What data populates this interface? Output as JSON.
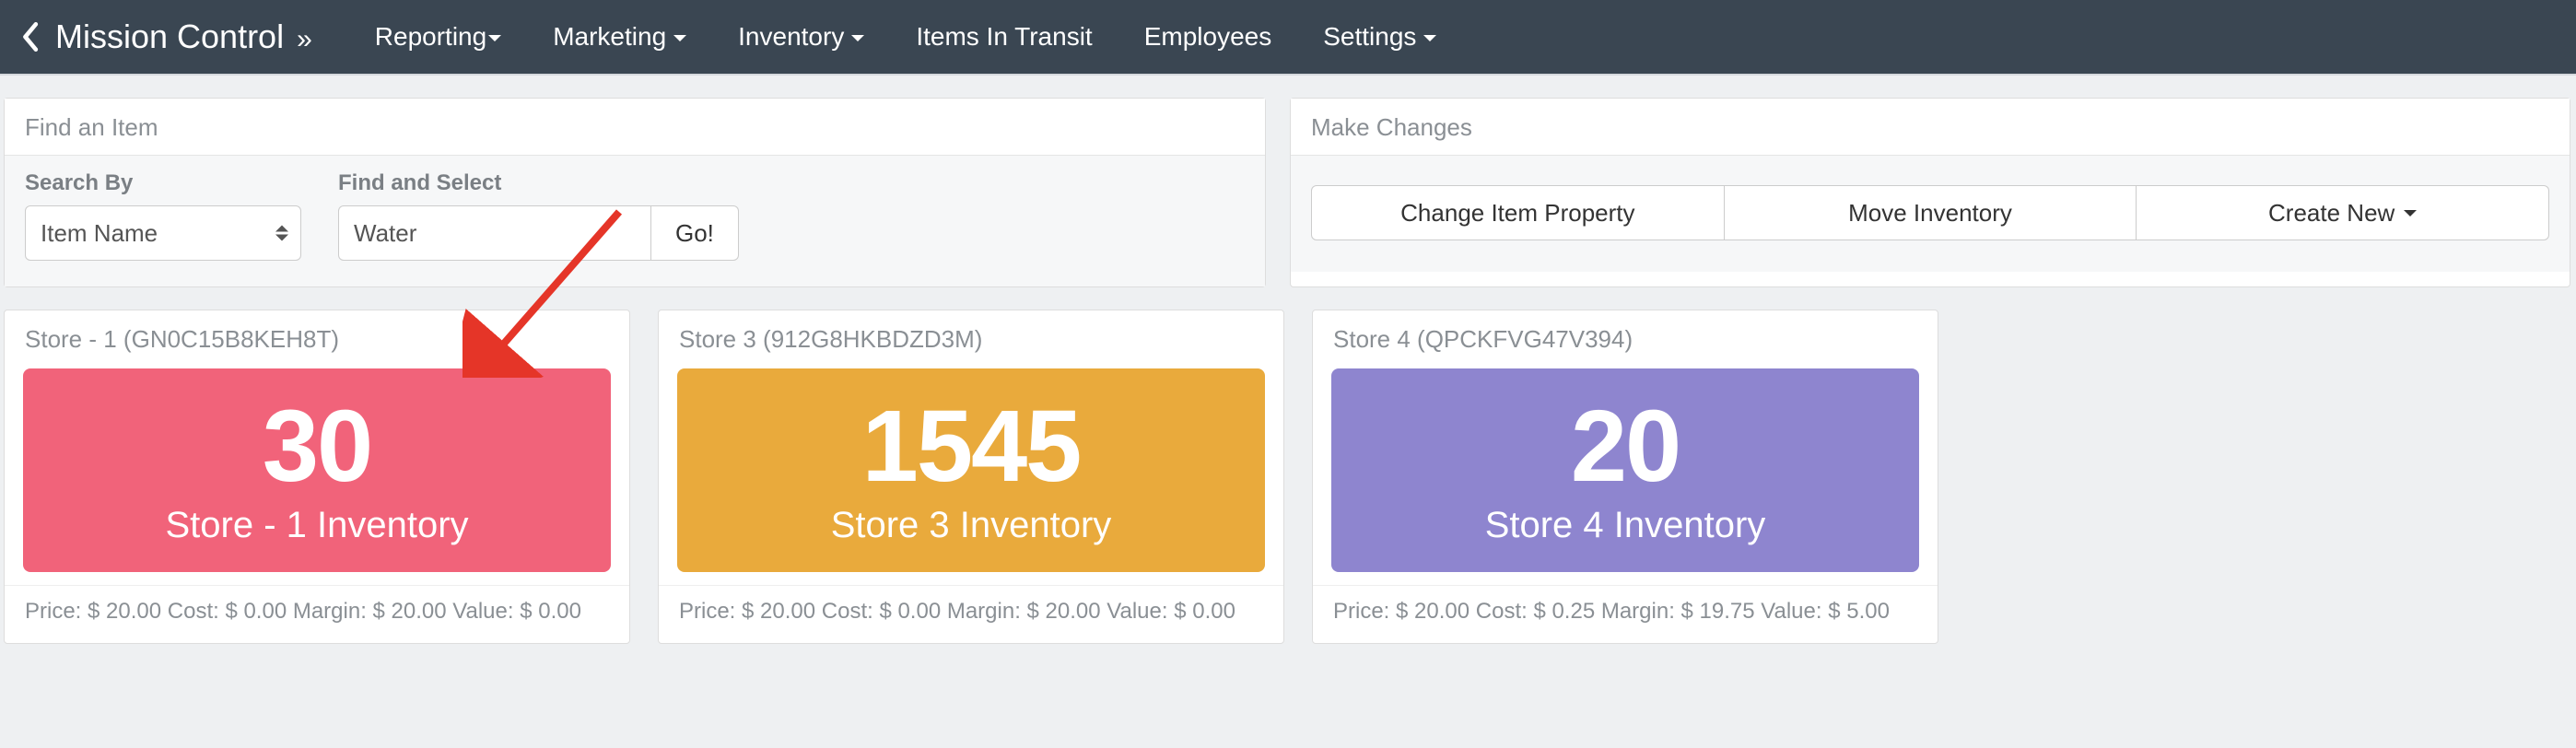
{
  "nav": {
    "brand": "Mission Control",
    "brand_suffix": "»",
    "items": [
      {
        "label": "Reporting",
        "caret": true,
        "tight": true
      },
      {
        "label": "Marketing",
        "caret": true
      },
      {
        "label": "Inventory",
        "caret": true
      },
      {
        "label": "Items In Transit",
        "caret": false
      },
      {
        "label": "Employees",
        "caret": false
      },
      {
        "label": "Settings",
        "caret": true
      }
    ]
  },
  "find_panel": {
    "title": "Find an Item",
    "search_by_label": "Search By",
    "search_by_value": "Item Name",
    "find_select_label": "Find and Select",
    "find_value": "Water",
    "go_label": "Go!"
  },
  "changes_panel": {
    "title": "Make Changes",
    "buttons": [
      "Change Item Property",
      "Move Inventory",
      "Create New"
    ],
    "last_has_caret": true
  },
  "stores": [
    {
      "title": "Store - 1 (GN0C15B8KEH8T)",
      "count": "30",
      "label": "Store - 1 Inventory",
      "color": "pink",
      "footer": "Price: $ 20.00 Cost: $ 0.00 Margin: $ 20.00 Value: $ 0.00"
    },
    {
      "title": "Store 3 (912G8HKBDZD3M)",
      "count": "1545",
      "label": "Store 3 Inventory",
      "color": "orange",
      "footer": "Price: $ 20.00 Cost: $ 0.00 Margin: $ 20.00 Value: $ 0.00"
    },
    {
      "title": "Store 4 (QPCKFVG47V394)",
      "count": "20",
      "label": "Store 4 Inventory",
      "color": "purple",
      "footer": "Price: $ 20.00 Cost: $ 0.25 Margin: $ 19.75 Value: $ 5.00"
    }
  ]
}
